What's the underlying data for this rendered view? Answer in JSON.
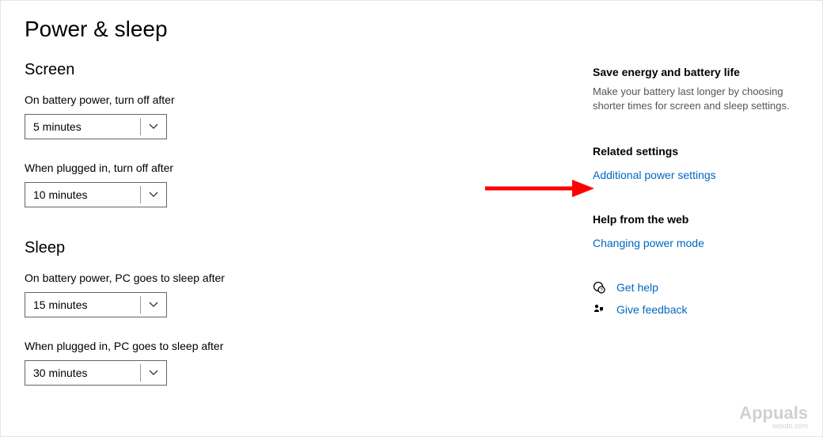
{
  "page_title": "Power & sleep",
  "main": {
    "screen": {
      "heading": "Screen",
      "battery_label": "On battery power, turn off after",
      "battery_value": "5 minutes",
      "plugged_label": "When plugged in, turn off after",
      "plugged_value": "10 minutes"
    },
    "sleep": {
      "heading": "Sleep",
      "battery_label": "On battery power, PC goes to sleep after",
      "battery_value": "15 minutes",
      "plugged_label": "When plugged in, PC goes to sleep after",
      "plugged_value": "30 minutes"
    }
  },
  "sidebar": {
    "save_heading": "Save energy and battery life",
    "save_text": "Make your battery last longer by choosing shorter times for screen and sleep settings.",
    "related_heading": "Related settings",
    "related_link": "Additional power settings",
    "help_heading": "Help from the web",
    "help_link": "Changing power mode",
    "get_help": "Get help",
    "give_feedback": "Give feedback"
  },
  "watermark": {
    "logo": "Appuals",
    "domain": "wsxdn.com"
  }
}
